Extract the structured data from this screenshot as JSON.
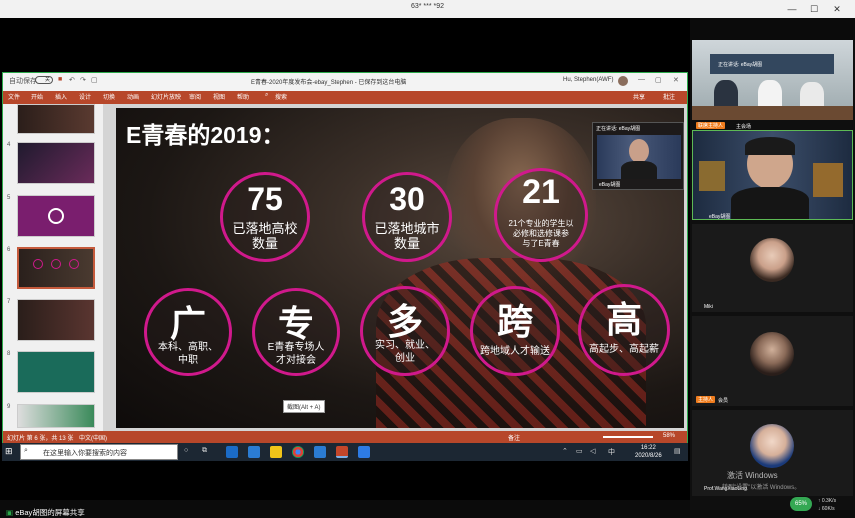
{
  "meeting": {
    "title": "63* *** *92",
    "share_label": "eBay胡图的屏幕共享",
    "activate_line1": "激活 Windows",
    "activate_line2": "转到\"设置\"以激活 Windows。",
    "net_percent": "65%",
    "net_up": "↑ 0.3K/s",
    "net_down": "↓ 60K/s"
  },
  "ppt": {
    "autosave_label": "自动保存",
    "autosave_state": "关",
    "doc_title": "E青春-2020年度发布会-ebay_Stephen - 已保存到这台电脑",
    "user": "Hu, Stephen(AWF)",
    "ribbon_tabs": [
      "文件",
      "开始",
      "插入",
      "设计",
      "切换",
      "动画",
      "幻灯片放映",
      "审阅",
      "视图",
      "帮助",
      "搜索"
    ],
    "share_btn": "共享",
    "comment_btn": "批注",
    "status_slide": "幻灯片 第 6 张，共 13 张",
    "status_lang": "中文(中国)",
    "status_notes": "备注",
    "zoom": "58%",
    "tooltip": "截图(Alt + A)"
  },
  "thumbnails": [
    {
      "num": "4",
      "selected": false
    },
    {
      "num": "5",
      "selected": false
    },
    {
      "num": "6",
      "selected": true
    },
    {
      "num": "7",
      "selected": false
    },
    {
      "num": "8",
      "selected": false
    },
    {
      "num": "9",
      "selected": false
    }
  ],
  "slide": {
    "title": "E青春的2019：",
    "stats": [
      {
        "value": "75",
        "label": "已落地高校\n数量"
      },
      {
        "value": "30",
        "label": "已落地城市\n数量"
      },
      {
        "value": "21",
        "label": "21个专业的学生以\n必修和选修课参\n与了E青春"
      }
    ],
    "features": [
      {
        "char": "广",
        "label": "本科、高职、\n中职"
      },
      {
        "char": "专",
        "label": "E青春专场人\n才对接会"
      },
      {
        "char": "多",
        "label": "实习、就业、\n创业"
      },
      {
        "char": "跨",
        "label": "跨地域人才输送"
      },
      {
        "char": "高",
        "label": "高起步、高起薪"
      }
    ],
    "speaker_overlay": "正在讲话: eBay胡图",
    "speaker_name": "eBay胡图"
  },
  "taskbar": {
    "search_placeholder": "在这里输入你要搜索的内容",
    "time": "16:22",
    "date": "2020/8/26",
    "ime": "中"
  },
  "panel": {
    "speaking_label": "正在讲话: eBay胡图",
    "tiles": [
      {
        "name": "主会场",
        "host": "联席主持人"
      },
      {
        "name": "eBay胡图",
        "host": ""
      },
      {
        "name": "Miki",
        "host": ""
      },
      {
        "name": "会员",
        "host": "主持人"
      },
      {
        "name": "Prof.WangXiaoLing",
        "host": ""
      }
    ]
  },
  "colors": {
    "accent": "#d0198c",
    "ppt_red": "#b7472a",
    "green_border": "#2ba84a"
  }
}
